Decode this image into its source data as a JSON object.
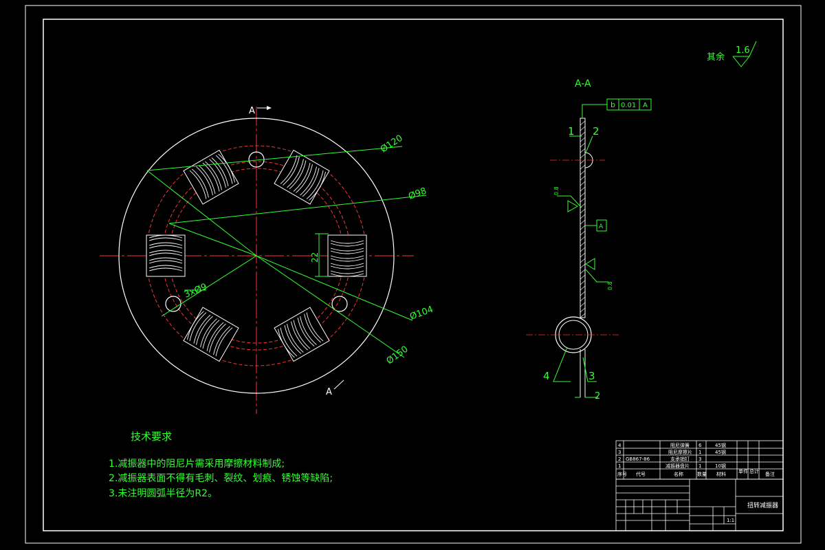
{
  "colors": {
    "background": "#000000",
    "outline": "#ffffff",
    "dimension": "#33ff33",
    "center": "#ff3333",
    "hidden": "#ff3333"
  },
  "section_label": "A-A",
  "cut_marks": {
    "top": "A",
    "bottom": "A"
  },
  "surface_roughness": {
    "prefix": "其余",
    "value": "1.6"
  },
  "dims": {
    "d120": "Ø120",
    "d98": "Ø98",
    "d104": "Ø104",
    "d150": "Ø150",
    "holes": "3xØ9",
    "slot": "22",
    "thickness": "2"
  },
  "tolerance_frame": {
    "symbol": "b",
    "value": "0.01",
    "datum": "A"
  },
  "datum_box": "A",
  "weld_marks": {
    "upper": "0.8",
    "lower": "0.8"
  },
  "callouts": [
    "1",
    "2",
    "3",
    "4"
  ],
  "tech_req": {
    "title": "技术要求",
    "items": [
      "1.减振器中的阻尼片需采用摩擦材料制成;",
      "2.减振器表面不得有毛刺、裂纹、划痕、锈蚀等缺陷;",
      "3.未注明圆弧半径为R2。"
    ]
  },
  "bom": [
    {
      "no": "4",
      "code": "",
      "name": "阻尼弹簧",
      "qty": "6",
      "material": "45钢"
    },
    {
      "no": "3",
      "code": "",
      "name": "阻尼摩擦片",
      "qty": "1",
      "material": "45钢"
    },
    {
      "no": "2",
      "code": "GB867-86",
      "name": "支承销钉",
      "qty": "3",
      "material": ""
    },
    {
      "no": "1",
      "code": "",
      "name": "减振器盘片",
      "qty": "1",
      "material": "10钢"
    }
  ],
  "bom_header": [
    "序号",
    "代号",
    "名称",
    "数量",
    "材料",
    "单件",
    "总计",
    "备注"
  ],
  "title_block": {
    "name": "扭转减振器",
    "scale": "1:1"
  }
}
